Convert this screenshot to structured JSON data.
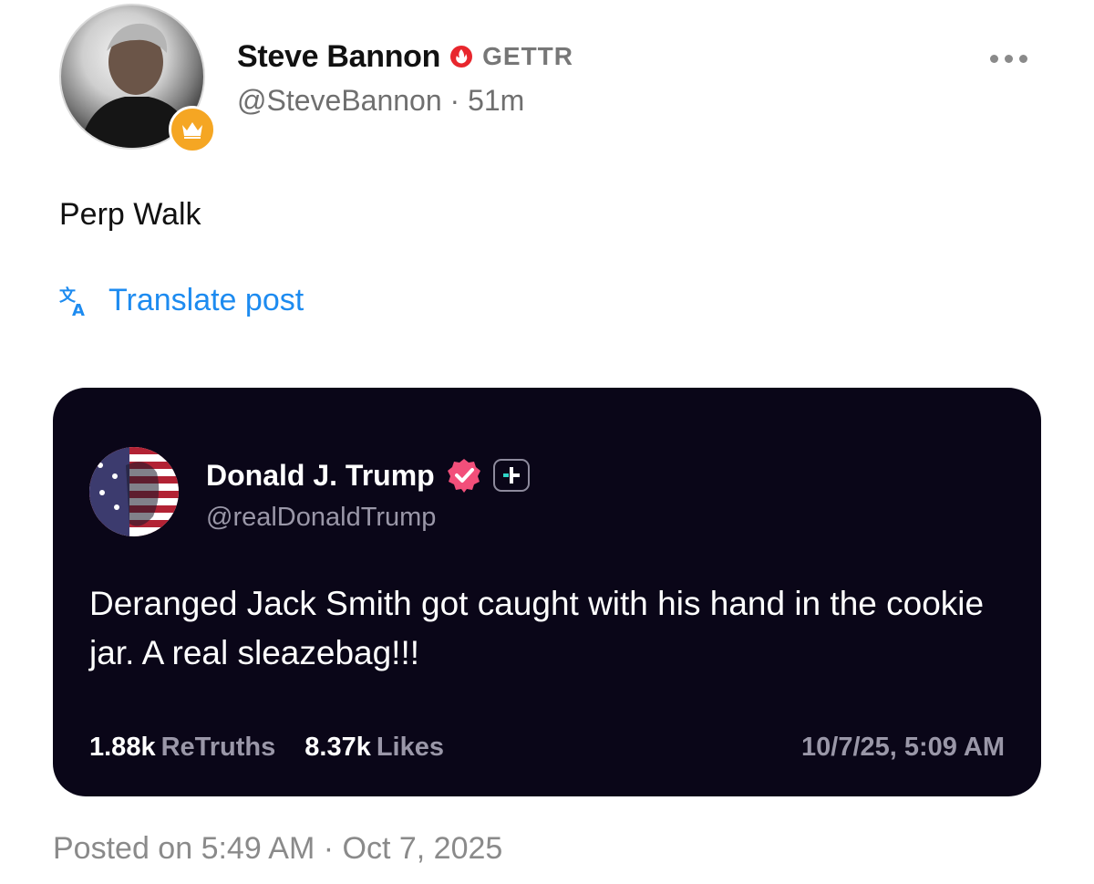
{
  "header": {
    "author_name": "Steve Bannon",
    "platform_label": "GETTR",
    "handle_time": "@SteveBannon · 51m",
    "verified_icon": "flame-verified-icon",
    "badge_icon": "crown-icon",
    "more_icon": "more-dots-icon"
  },
  "post": {
    "text": "Perp Walk",
    "translate_label": "Translate post"
  },
  "quoted": {
    "name": "Donald J. Trump",
    "handle": "@realDonaldTrump",
    "text": "Deranged Jack Smith got caught with his hand in the cookie jar. A real sleazebag!!!",
    "retruths_count": "1.88k",
    "retruths_label": "ReTruths",
    "likes_count": "8.37k",
    "likes_label": "Likes",
    "timestamp": "10/7/25, 5:09 AM"
  },
  "footer": {
    "posted_on": "Posted on 5:49 AM · Oct 7, 2025"
  },
  "colors": {
    "link": "#1d8bf0",
    "card_bg": "#0a0618",
    "verified_red": "#e8262d",
    "verified_pink": "#f24f7a",
    "crown_badge": "#f5a623"
  }
}
